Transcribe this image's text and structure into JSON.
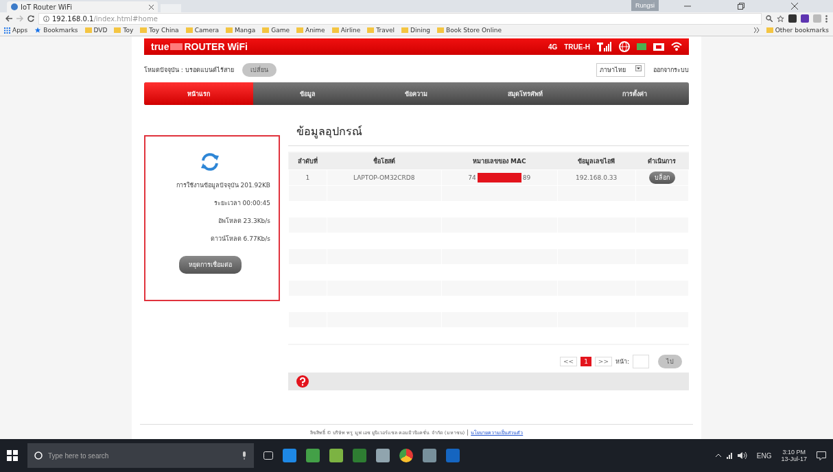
{
  "browser": {
    "tab_title": "IoT Router WiFi",
    "profile": "Rungsi",
    "address_host": "192.168.0.1",
    "address_path": "/index.html#home",
    "bookmarks": [
      {
        "label": "Apps",
        "kind": "apps"
      },
      {
        "label": "Bookmarks",
        "kind": "star"
      },
      {
        "label": "DVD",
        "kind": "folder"
      },
      {
        "label": "Toy",
        "kind": "folder"
      },
      {
        "label": "Toy China",
        "kind": "folder"
      },
      {
        "label": "Camera",
        "kind": "folder"
      },
      {
        "label": "Manga",
        "kind": "folder"
      },
      {
        "label": "Game",
        "kind": "folder"
      },
      {
        "label": "Anime",
        "kind": "folder"
      },
      {
        "label": "Airline",
        "kind": "folder"
      },
      {
        "label": "Travel",
        "kind": "folder"
      },
      {
        "label": "Dining",
        "kind": "folder"
      },
      {
        "label": "Book Store Online",
        "kind": "folder"
      }
    ],
    "other_bookmarks": "Other bookmarks"
  },
  "header": {
    "logo_brand": "true",
    "logo_product": "ROUTER WiFi",
    "network": "4G",
    "operator": "TRUE-H"
  },
  "mode": {
    "label": "โหมดปัจจุบัน : บรอดแบนด์ไร้สาย",
    "button": "เปลี่ยน",
    "language": "ภาษาไทย",
    "logout": "ออกจากระบบ"
  },
  "tabs": [
    {
      "label": "หน้าแรก",
      "selected": true
    },
    {
      "label": "ข้อมูล",
      "selected": false
    },
    {
      "label": "ข้อความ",
      "selected": false
    },
    {
      "label": "สมุดโทรศัพท์",
      "selected": false
    },
    {
      "label": "การตั้งค่า",
      "selected": false
    }
  ],
  "status_panel": {
    "lines": [
      "การใช้งานข้อมูลปัจจุบัน 201.92KB",
      "ระยะเวลา 00:00:45",
      "อัพโหลด 23.3Kb/s",
      "ดาวน์โหลด 6.77Kb/s"
    ],
    "button": "หยุดการเชื่อมต่อ"
  },
  "page_title": "ข้อมูลอุปกรณ์",
  "table": {
    "columns": [
      "ลำดับที่",
      "ชื่อโฮสต์",
      "หมายเลขของ MAC",
      "ข้อมูลเลขไอพี",
      "ดำเนินการ"
    ],
    "rows": [
      {
        "index": "1",
        "host": "LAPTOP-OM32CRD8",
        "mac_start": "74",
        "mac_end": "89",
        "ip": "192.168.0.33",
        "action": "บล็อก"
      }
    ]
  },
  "pagination": {
    "prev": "<<",
    "pages": [
      {
        "label": "1",
        "selected": true
      }
    ],
    "next": ">>",
    "page_label": "หน้า:",
    "go": "ไป"
  },
  "footer": {
    "copyright": "ลิขสิทธิ์ © บริษัท ทรู มูฟ เอช ยูนิเวอร์แซล คอมมิวนิเคชั่น จำกัด (มหาชน)",
    "link": "นโยบายความเป็นส่วนตัว"
  },
  "taskbar": {
    "search_placeholder": "Type here to search",
    "language": "ENG",
    "time": "3:10 PM",
    "date": "13-Jul-17"
  }
}
